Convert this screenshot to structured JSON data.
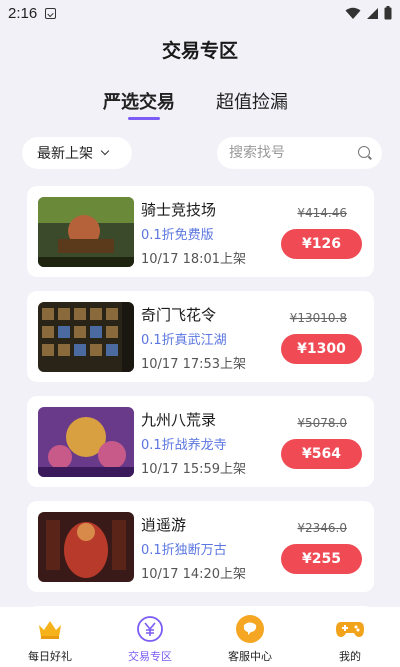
{
  "status_bar": {
    "time": "2:16"
  },
  "header": {
    "title": "交易专区"
  },
  "tabs": [
    {
      "label": "严选交易",
      "active": true
    },
    {
      "label": "超值捡漏",
      "active": false
    }
  ],
  "filter": {
    "sort_label": "最新上架",
    "search_placeholder": "搜索找号"
  },
  "listings": [
    {
      "name": "骑士竞技场",
      "tag": "0.1折免费版",
      "time": "10/17 18:01上架",
      "original_price": "¥414.46",
      "price": "¥126",
      "thumb_colors": [
        "#3a4a2a",
        "#b5623a",
        "#6a8a3a"
      ]
    },
    {
      "name": "奇门飞花令",
      "tag": "0.1折真武江湖",
      "time": "10/17 17:53上架",
      "original_price": "¥13010.8",
      "price": "¥1300",
      "thumb_colors": [
        "#2a2418",
        "#8a6a3a",
        "#4a6aa0"
      ]
    },
    {
      "name": "九州八荒录",
      "tag": "0.1折战养龙寺",
      "time": "10/17 15:59上架",
      "original_price": "¥5078.0",
      "price": "¥564",
      "thumb_colors": [
        "#6a3a8a",
        "#d8a040",
        "#c85a8a"
      ]
    },
    {
      "name": "逍遥游",
      "tag": "0.1折独断万古",
      "time": "10/17 14:20上架",
      "original_price": "¥2346.0",
      "price": "¥255",
      "thumb_colors": [
        "#3a1a18",
        "#b83a2a",
        "#d88a4a"
      ]
    }
  ],
  "bottom_nav": [
    {
      "label": "每日好礼",
      "icon": "crown-icon",
      "active": false
    },
    {
      "label": "交易专区",
      "icon": "yen-icon",
      "active": true
    },
    {
      "label": "客服中心",
      "icon": "chat-bubble-icon",
      "active": false
    },
    {
      "label": "我的",
      "icon": "gamepad-icon",
      "active": false
    }
  ],
  "colors": {
    "accent": "#7b5cf4",
    "price_button": "#f04a55",
    "tag_text": "#5b76e0",
    "background": "#f1f1f7"
  }
}
